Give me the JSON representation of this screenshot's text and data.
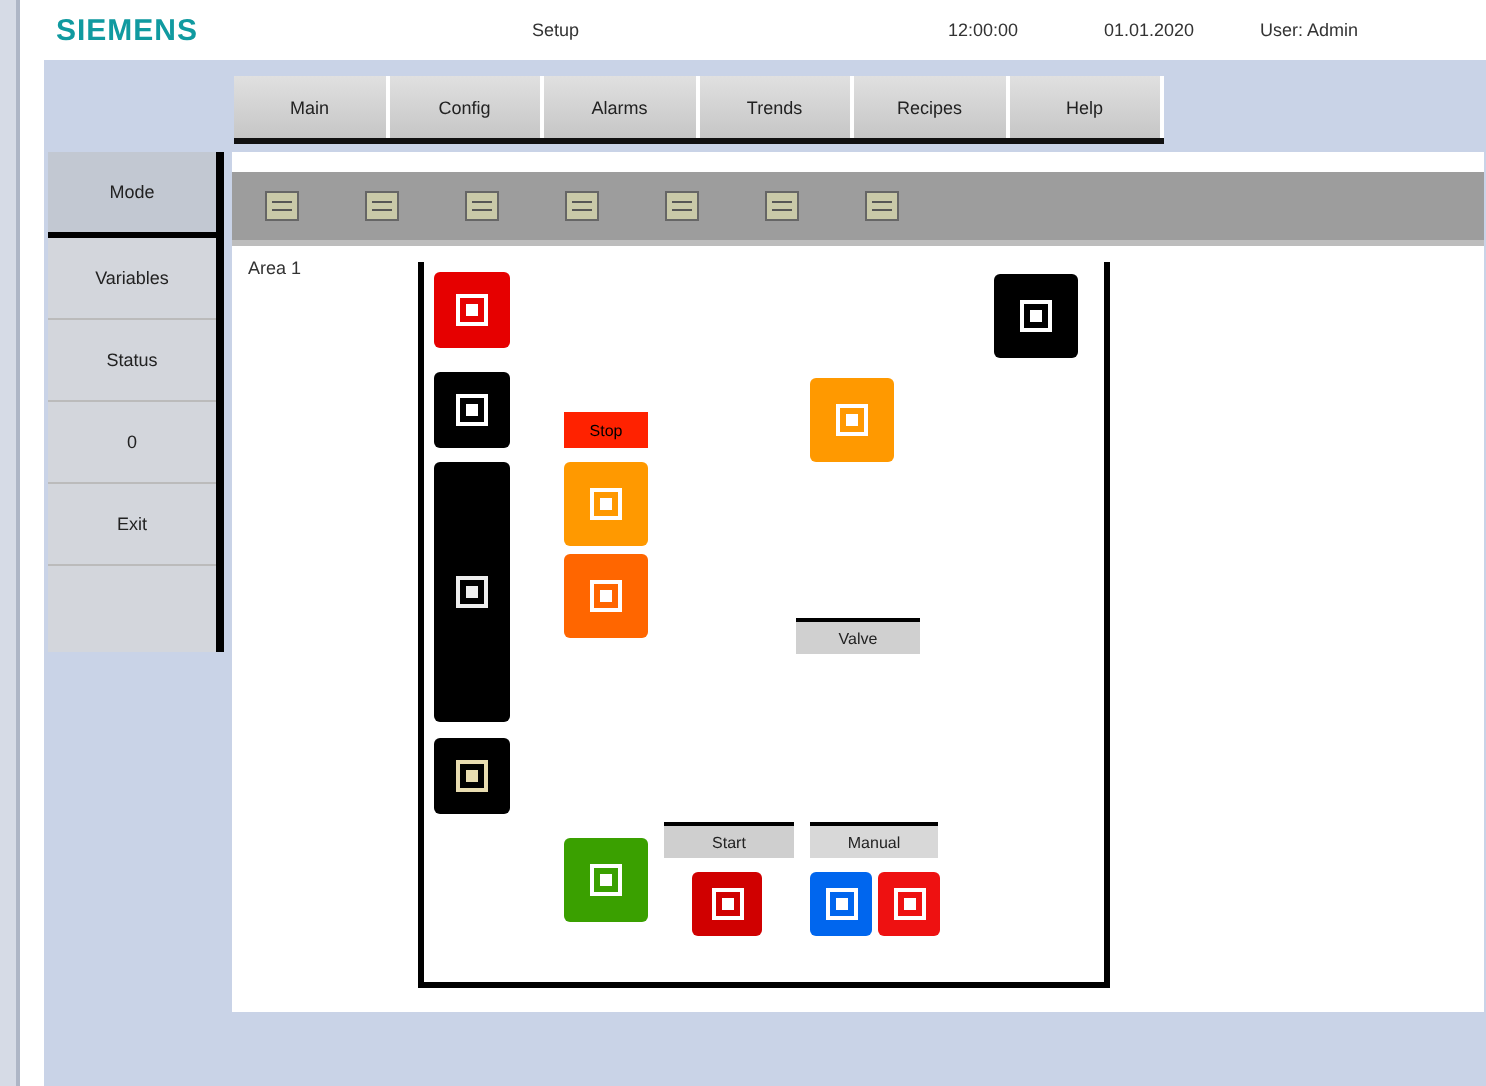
{
  "header": {
    "logo": "SIEMENS",
    "screen_name": "Setup",
    "time": "12:00:00",
    "date": "01.01.2020",
    "user": "User: Admin"
  },
  "tabs": [
    {
      "label": "Main",
      "selected": false
    },
    {
      "label": "Config",
      "selected": false
    },
    {
      "label": "Alarms",
      "selected": false
    },
    {
      "label": "Trends",
      "selected": false
    },
    {
      "label": "Recipes",
      "selected": false
    },
    {
      "label": "Help",
      "selected": false
    }
  ],
  "sidebar": [
    {
      "label": "Mode",
      "selected": true
    },
    {
      "label": "Variables",
      "selected": false
    },
    {
      "label": "Status",
      "selected": false
    },
    {
      "label": "0",
      "selected": false
    },
    {
      "label": "Exit",
      "selected": false
    }
  ],
  "area_label": "Area 1",
  "canvas": {
    "alarm_label": "Stop",
    "valve_label": "Valve",
    "button_1": "Start",
    "button_2": "Manual"
  }
}
